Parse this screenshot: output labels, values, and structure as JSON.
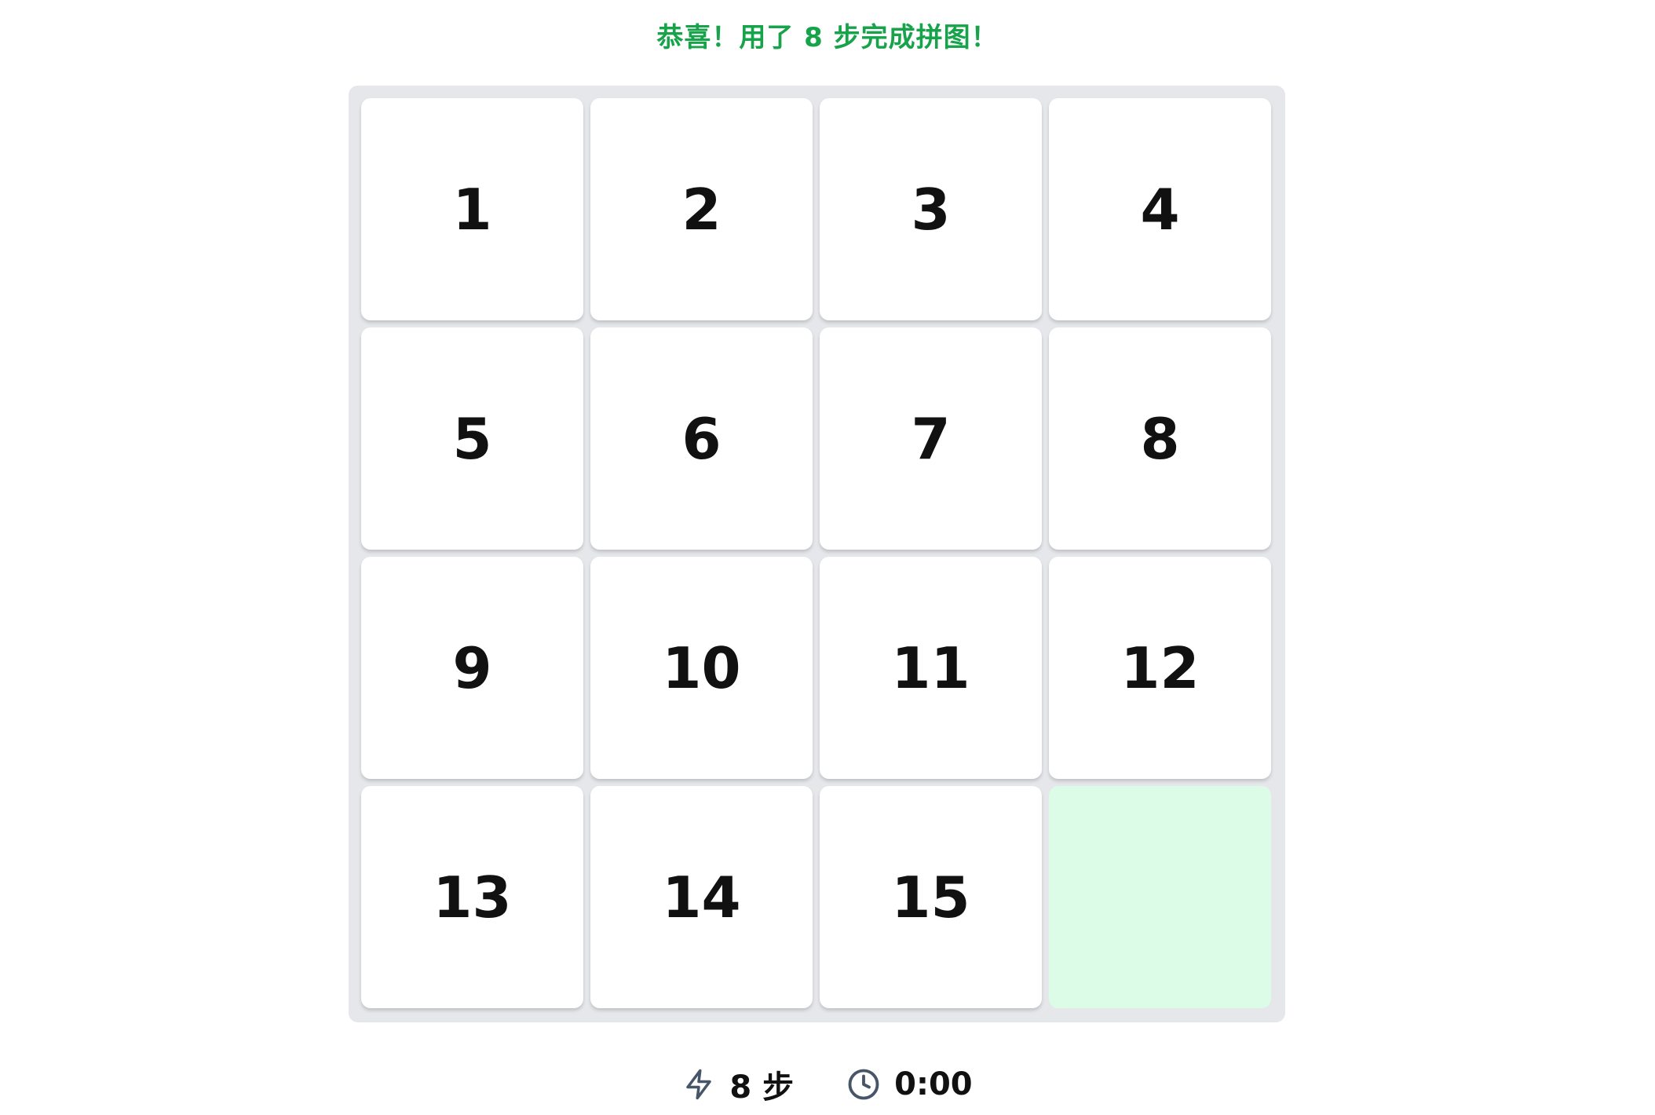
{
  "status_message": "恭喜！用了 8 步完成拼图！",
  "colors": {
    "success": "#16a34a",
    "board_bg": "#e5e7eb",
    "tile_bg": "#ffffff",
    "empty_tile_bg": "#dcfce7",
    "icon": "#475569"
  },
  "board": {
    "size": 4,
    "tiles": [
      "1",
      "2",
      "3",
      "4",
      "5",
      "6",
      "7",
      "8",
      "9",
      "10",
      "11",
      "12",
      "13",
      "14",
      "15",
      ""
    ]
  },
  "stats": {
    "moves_icon": "lightning-icon",
    "moves_label": "8 步",
    "time_icon": "clock-icon",
    "time_label": "0:00"
  }
}
